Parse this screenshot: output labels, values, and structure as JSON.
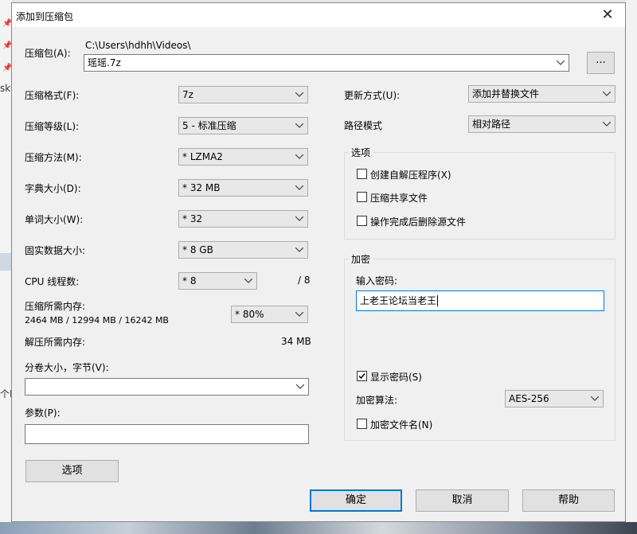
{
  "dialog": {
    "title": "添加到压缩包",
    "close_glyph": "✕",
    "archive_label": "压缩包(A):",
    "archive_path": "C:\\Users\\hdhh\\Videos\\",
    "archive_name": "瑶瑶.7z",
    "browse_label": "...",
    "format_label": "压缩格式(F):",
    "format_value": "7z",
    "level_label": "压缩等级(L):",
    "level_value": "5 - 标准压缩",
    "method_label": "压缩方法(M):",
    "method_value": "* LZMA2",
    "dict_label": "字典大小(D):",
    "dict_value": "* 32 MB",
    "word_label": "单词大小(W):",
    "word_value": "* 32",
    "solid_label": "固实数据大小:",
    "solid_value": "* 8 GB",
    "cpu_label": "CPU 线程数:",
    "cpu_value": "* 8",
    "cpu_total": "/ 8",
    "mem_comp_label": "压缩所需内存:",
    "mem_comp_detail": "2464 MB / 12994 MB / 16242 MB",
    "mem_comp_value": "* 80%",
    "mem_decomp_label": "解压所需内存:",
    "mem_decomp_value": "34 MB",
    "volume_label": "分卷大小，字节(V):",
    "volume_value": "",
    "params_label": "参数(P):",
    "params_value": "",
    "options_button": "选项",
    "update_label": "更新方式(U):",
    "update_value": "添加并替换文件",
    "path_mode_label": "路径模式",
    "path_mode_value": "相对路径",
    "options_group_title": "选项",
    "opt_sfx": "创建自解压程序(X)",
    "opt_shared": "压缩共享文件",
    "opt_delete": "操作完成后删除源文件",
    "encrypt_group_title": "加密",
    "password_label": "输入密码:",
    "password_value": "上老王论坛当老王",
    "show_password": "显示密码(S)",
    "enc_method_label": "加密算法:",
    "enc_method_value": "AES-256",
    "enc_filenames": "加密文件名(N)",
    "ok_button": "确定",
    "cancel_button": "取消",
    "help_button": "帮助"
  },
  "background": {
    "frag_1": "sk[",
    "frag_2": "个I"
  },
  "icons": {
    "close": "close-icon",
    "dropdown": "chevron-down-icon",
    "checkbox": "checkbox-icon",
    "pin": "pin-icon"
  }
}
